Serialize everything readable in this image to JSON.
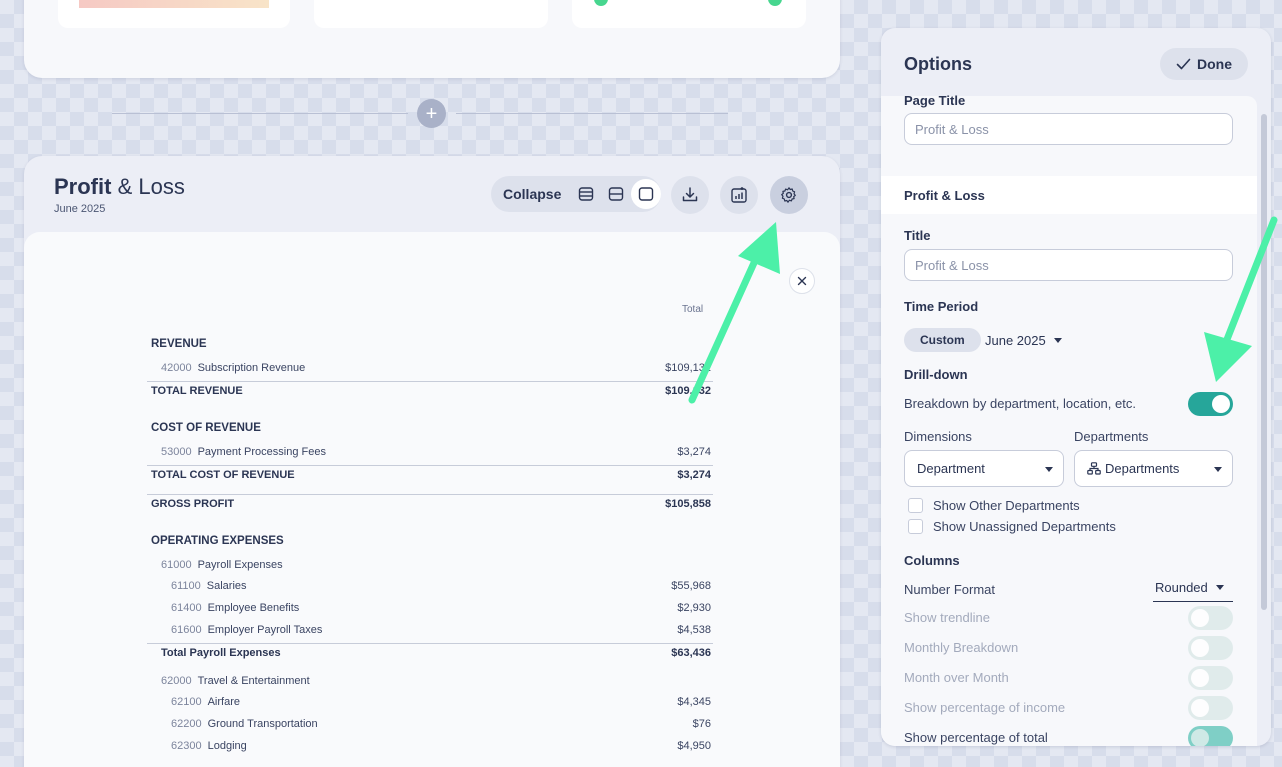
{
  "report": {
    "title_bold": "Profit",
    "title_rest": "& Loss",
    "date": "June 2025",
    "collapse_label": "Collapse",
    "column_header": "Total",
    "rows": [
      {
        "kind": "section",
        "label": "REVENUE",
        "account": "",
        "amount": ""
      },
      {
        "kind": "line",
        "account": "42000",
        "label": "Subscription Revenue",
        "amount": "$109,132"
      },
      {
        "kind": "total",
        "account": "",
        "label": "TOTAL REVENUE",
        "amount": "$109,132"
      },
      {
        "kind": "section",
        "label": "COST OF REVENUE",
        "account": "",
        "amount": ""
      },
      {
        "kind": "line",
        "account": "53000",
        "label": "Payment Processing Fees",
        "amount": "$3,274"
      },
      {
        "kind": "total",
        "account": "",
        "label": "TOTAL COST OF REVENUE",
        "amount": "$3,274"
      },
      {
        "kind": "total",
        "account": "",
        "label": "GROSS PROFIT",
        "amount": "$105,858"
      },
      {
        "kind": "section",
        "label": "OPERATING EXPENSES",
        "account": "",
        "amount": ""
      },
      {
        "kind": "group",
        "account": "61000",
        "label": "Payroll Expenses",
        "amount": ""
      },
      {
        "kind": "subline",
        "account": "61100",
        "label": "Salaries",
        "amount": "$55,968"
      },
      {
        "kind": "subline",
        "account": "61400",
        "label": "Employee Benefits",
        "amount": "$2,930"
      },
      {
        "kind": "subline",
        "account": "61600",
        "label": "Employer Payroll Taxes",
        "amount": "$4,538"
      },
      {
        "kind": "subtotal",
        "account": "",
        "label": "Total Payroll Expenses",
        "amount": "$63,436"
      },
      {
        "kind": "group",
        "account": "62000",
        "label": "Travel & Entertainment",
        "amount": ""
      },
      {
        "kind": "subline",
        "account": "62100",
        "label": "Airfare",
        "amount": "$4,345"
      },
      {
        "kind": "subline",
        "account": "62200",
        "label": "Ground Transportation",
        "amount": "$76"
      },
      {
        "kind": "subline",
        "account": "62300",
        "label": "Lodging",
        "amount": "$4,950"
      }
    ]
  },
  "options": {
    "header": "Options",
    "done_label": "Done",
    "page_title_label": "Page Title",
    "page_title_value": "Profit & Loss",
    "section_label": "Profit & Loss",
    "title_label": "Title",
    "title_value": "Profit & Loss",
    "time_period_label": "Time Period",
    "time_period_chip": "Custom",
    "time_period_value": "June 2025",
    "drilldown_label": "Drill-down",
    "drilldown_text": "Breakdown by department, location, etc.",
    "dimensions_label": "Dimensions",
    "dimensions_value": "Department",
    "departments_label": "Departments",
    "departments_value": "Departments",
    "show_other": "Show Other Departments",
    "show_unassigned": "Show Unassigned Departments",
    "columns_label": "Columns",
    "number_format_label": "Number Format",
    "number_format_value": "Rounded",
    "show_trendline": "Show trendline",
    "monthly_breakdown": "Monthly Breakdown",
    "month_over_month": "Month over Month",
    "pct_income": "Show percentage of income",
    "pct_total": "Show percentage of total"
  },
  "colors": {
    "accent": "#26a69a",
    "arrow": "#4cf0a8",
    "text": "#2b3553"
  }
}
